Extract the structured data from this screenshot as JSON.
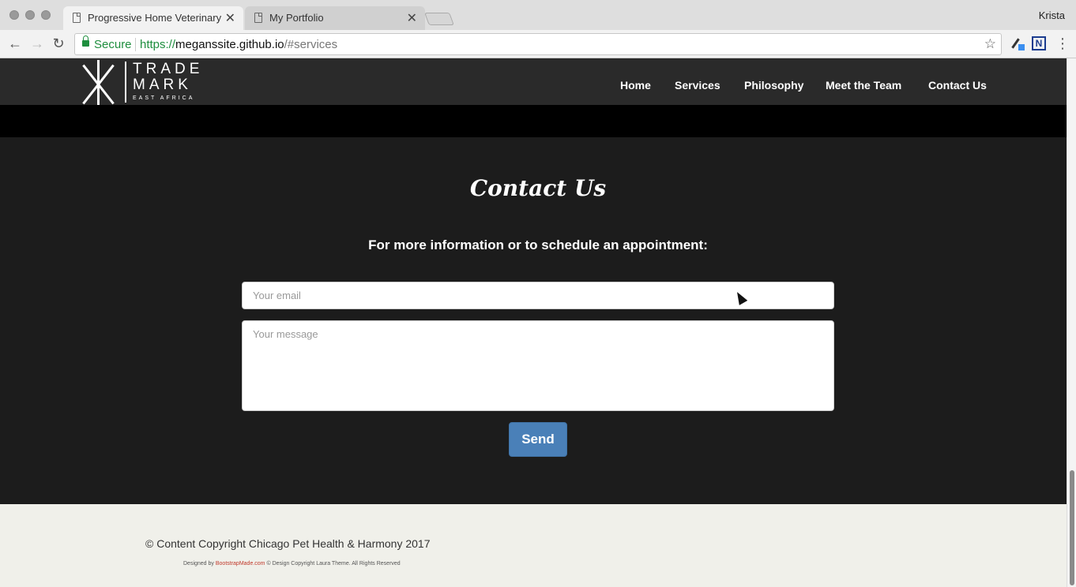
{
  "browser": {
    "tabs": [
      {
        "title": "Progressive Home Veterinary C",
        "close": "✕"
      },
      {
        "title": "My Portfolio",
        "close": "✕"
      }
    ],
    "profile_name": "Krista",
    "icons": {
      "back": "←",
      "forward": "→",
      "reload": "↻",
      "star": "☆",
      "menu": "⋮"
    },
    "address": {
      "secure_label": "Secure",
      "scheme": "https://",
      "host": "meganssite.github.io",
      "path": "/#services"
    },
    "extension_label": "N"
  },
  "site": {
    "logo": {
      "line1": "TRADE",
      "line2": "MARK",
      "line3": "EAST AFRICA"
    },
    "nav": [
      "Home",
      "Services",
      "Philosophy",
      "Meet the Team",
      "Contact Us"
    ]
  },
  "contact": {
    "title": "Contact Us",
    "subtitle": "For more information or to schedule an appointment:",
    "email_placeholder": "Your email",
    "message_placeholder": "Your message",
    "send_label": "Send"
  },
  "footer": {
    "copyright": "© Content Copyright Chicago Pet Health & Harmony 2017",
    "designed_by": "Designed by ",
    "designer_link": "BootstrapMade.com",
    "design_copyright": " © Design Copyright Laura Theme. All Rights Reserved"
  },
  "colors": {
    "accent": "#4a80b8",
    "secure_green": "#1e8e3e",
    "footer_bg": "#f0f0ea"
  }
}
